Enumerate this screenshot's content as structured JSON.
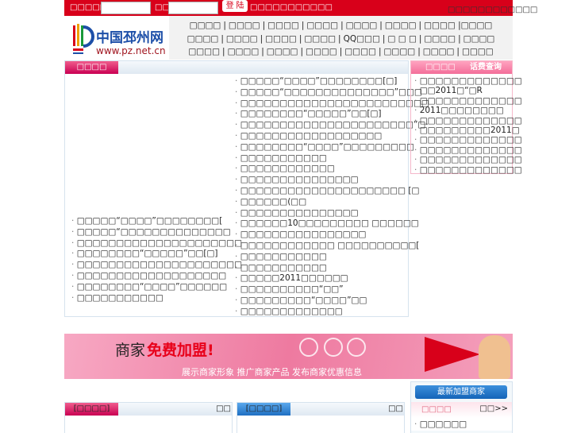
{
  "topbar": {
    "username_label": "□□□□□",
    "password_label": "□□",
    "login_button": "登 陆",
    "register_text": "□□□□□□□□□□□",
    "right_links": "□□□□□□□□□□□□"
  },
  "logo": {
    "name": "中国邳州网",
    "url": "www.pz.net.cn"
  },
  "nav": {
    "rows": [
      [
        "□□□□",
        "□□□□",
        "□□□□",
        "□□□□",
        "□□□□",
        "□□□□",
        "□□□□ |□□□□"
      ],
      [
        "□□□□",
        "□□□□",
        "□□□□",
        "□□□□",
        "QQ□□□",
        "□ □ □",
        "□□□□",
        "□□□□"
      ],
      [
        "□□□□",
        "□□□□",
        "□□□□",
        "□□□□",
        "□□□□",
        "□□□□",
        "□□□□",
        "□□□□"
      ]
    ]
  },
  "main": {
    "tab": "□□□□",
    "left_items": [
      "□□□□□“□□□□”□□□□□□□□[",
      "□□□□□“□□□□□□□□□□□□□□",
      "□□□□□□□□□□□□□□□□□□□□□",
      "□□□□□□□□“□□□□□”□□[□]",
      "□□□□□□□□□□□□□□□□□□□□□",
      "□□□□□□□□□□□□□□□□□□□",
      "□□□□□□□□“□□□□”□□□□□□",
      "□□□□□□□□□□□"
    ],
    "middle_items": [
      "□□□□□“□□□□”□□□□□□□□[□]",
      "□□□□□“□□□□□□□□□□□□□□”□□□",
      "□□□□□□□□□□□□□□□□□□□□□□□□",
      "□□□□□□□□“□□□□□”□□[□]",
      "□□□□□□□□□□□□□□□□□□□□□□”□·",
      "□□□□□□□□□□□□□□□□□□",
      "□□□□□□□□“□□□□”□□□□□□□□□",
      "□□□□□□□□□□□",
      "□□□□□□□□□□□□",
      "□□□□□□□□□□□□□□□",
      "□□□□□□□□□□□□□□□□□□□□□ [□",
      "□□□□□□(□□",
      "□□□□□□□□□□□□□□□",
      "□□□□□□10□□□□□□□□□ □□□□□□",
      "□□□□□□□□□□□□□□□□",
      "□□□□□□□□□□□□ □□□□□□□□□□[",
      "□□□□□□□□□□□",
      "□□□□□□□□□□□",
      "□□□□□2011□□□□□□",
      "□□□□□□□□□□“□□”",
      "□□□□□□□□□“□□□□”□□",
      "□□□□□□□□□□□□□"
    ]
  },
  "right": {
    "tab": "□□□□",
    "query_link": "话费查询",
    "items": [
      "□□□□□□□□□□□□□",
      "□□2011□“□R",
      "□□□□□□□□□□□□□",
      "2011□□□□□□□□",
      "□□□□□□□□□□□□□",
      "□□□□□□□□□2011□",
      "□□□□□□□□□□□□□",
      "□□□□□□□□□□□□□",
      "□□□□□□□□□□□□□",
      "□□□□□□□□□□□□□"
    ]
  },
  "banner": {
    "title_a": "商家",
    "title_b": "免费加盟!",
    "subtitle": "展示商家形象  推广商家产品  发布商家优惠信息"
  },
  "bottom": {
    "box1_tab": "[□□□□]",
    "box1_more": "□□",
    "box2_tab": "[□□□□]",
    "box2_more": "□□",
    "join_button": "最新加盟商家",
    "box3_tab": "□□□□",
    "box3_more": "□□>>",
    "box3_items": [
      "□□□□□□"
    ]
  }
}
